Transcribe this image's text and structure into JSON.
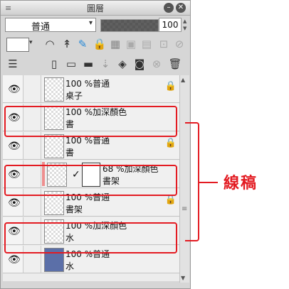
{
  "window": {
    "title": "圖層",
    "menu_icon": "≡",
    "minimize_icon": "–",
    "close_icon": "✕"
  },
  "controls": {
    "blend_mode": "普通",
    "blend_arrow": "▾",
    "opacity_level": 1.0,
    "opacity_value": "100"
  },
  "toolbar1": {
    "icons": [
      "layer-color-icon",
      "ruler-icon",
      "pen-icon",
      "brush-icon",
      "lock-icon",
      "lock-alpha-icon",
      "reference-icon",
      "draft-icon",
      "clip-icon",
      "mask-icon"
    ]
  },
  "toolbar2": {
    "icons": [
      "layer-props-icon",
      "new-raster-icon",
      "new-vector-icon",
      "new-folder-icon",
      "merge-down-icon",
      "delete-layer-icon",
      "mask-add-icon",
      "apply-mask-icon",
      "trash-icon"
    ]
  },
  "layers": [
    {
      "line1": "100 %普通",
      "line2": "桌子"
    },
    {
      "line1": "100 %加深顏色",
      "line2": "書"
    },
    {
      "line1": "100 %普通",
      "line2": "書"
    },
    {
      "line1": "68 %加深顏色",
      "line2": "書架"
    },
    {
      "line1": "100 %普通",
      "line2": "書架"
    },
    {
      "line1": "100 %加深顏色",
      "line2": "水"
    },
    {
      "line1": "100 %普通",
      "line2": "水"
    }
  ],
  "annotation": {
    "callout": "線稿",
    "color": "#e31b22"
  }
}
